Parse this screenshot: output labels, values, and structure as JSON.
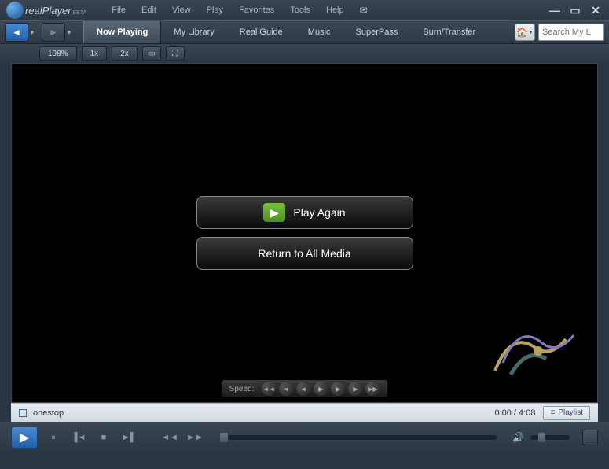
{
  "app": {
    "name": "realPlayer",
    "edition": "BETA"
  },
  "menu": [
    "File",
    "Edit",
    "View",
    "Play",
    "Favorites",
    "Tools",
    "Help"
  ],
  "tabs": {
    "active": "Now Playing",
    "items": [
      "Now Playing",
      "My Library",
      "Real Guide",
      "Music",
      "SuperPass",
      "Burn/Transfer"
    ]
  },
  "search": {
    "placeholder": "Search My L"
  },
  "toolbar": {
    "zoom": "198%",
    "scale1": "1x",
    "scale2": "2x"
  },
  "overlay": {
    "play_again": "Play Again",
    "return_media": "Return to All Media"
  },
  "speed": {
    "label": "Speed:"
  },
  "status": {
    "track": "onestop",
    "time": "0:00 / 4:08",
    "playlist_btn": "Playlist"
  }
}
